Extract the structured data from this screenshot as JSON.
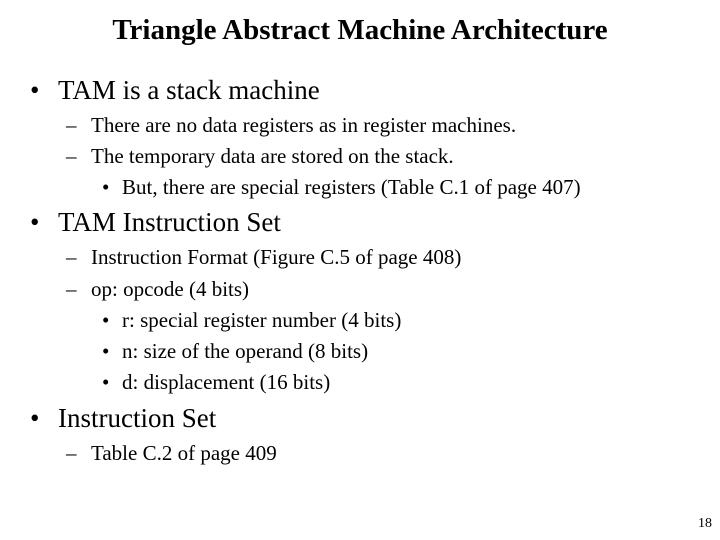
{
  "slide": {
    "title": "Triangle Abstract Machine Architecture",
    "page_number": "18",
    "bullet_glyph": "•",
    "dash_glyph": "–",
    "items": [
      {
        "level": 1,
        "text": "TAM is a stack machine"
      },
      {
        "level": 2,
        "text": "There are no data registers as in register machines."
      },
      {
        "level": 2,
        "text": "The temporary data are stored on the stack."
      },
      {
        "level": 3,
        "text": "But, there are special registers (Table C.1 of page 407)"
      },
      {
        "level": 1,
        "text": "TAM Instruction Set"
      },
      {
        "level": 2,
        "text": "Instruction Format (Figure C.5 of page 408)"
      },
      {
        "level": 2,
        "text": "op: opcode (4 bits)"
      },
      {
        "level": 3,
        "text": "r: special register number (4 bits)"
      },
      {
        "level": 3,
        "text": "n: size of the operand (8 bits)"
      },
      {
        "level": 3,
        "text": "d: displacement (16 bits)"
      },
      {
        "level": 1,
        "text": "Instruction Set"
      },
      {
        "level": 2,
        "text": "Table C.2 of page 409"
      }
    ]
  }
}
